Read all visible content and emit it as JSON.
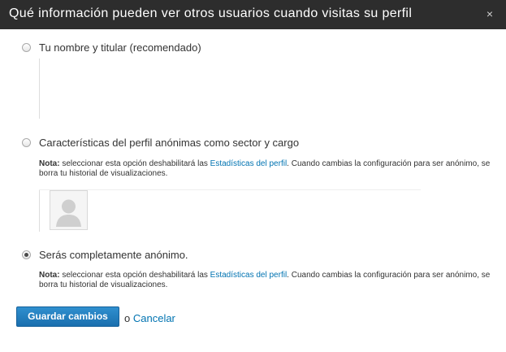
{
  "dialog": {
    "title": "Qué información pueden ver otros usuarios cuando visitas su perfil",
    "close_glyph": "×"
  },
  "options": [
    {
      "label": "Tu nombre y titular (recomendado)",
      "checked": false
    },
    {
      "label": "Características del perfil anónimas como sector y cargo",
      "checked": false,
      "note": {
        "bold": "Nota:",
        "before": " seleccionar esta opción deshabilitará las ",
        "link": "Estadísticas del perfil",
        "after": ". Cuando cambias la configuración para ser anónimo, se borra tu historial de visualizaciones."
      }
    },
    {
      "label": "Serás completamente anónimo.",
      "checked": true,
      "note": {
        "bold": "Nota:",
        "before": " seleccionar esta opción deshabilitará las ",
        "link": "Estadísticas del perfil",
        "after": ". Cuando cambias la configuración para ser anónimo, se borra tu historial de visualizaciones."
      }
    }
  ],
  "footer": {
    "save_label": "Guardar cambios",
    "separator": "o",
    "cancel_label": "Cancelar"
  },
  "colors": {
    "titlebar": "#2d2d2d",
    "link": "#0073b1",
    "button": "#1f7bbf"
  },
  "icons": {
    "close": "close-icon",
    "avatar": "anonymous-avatar-icon"
  }
}
